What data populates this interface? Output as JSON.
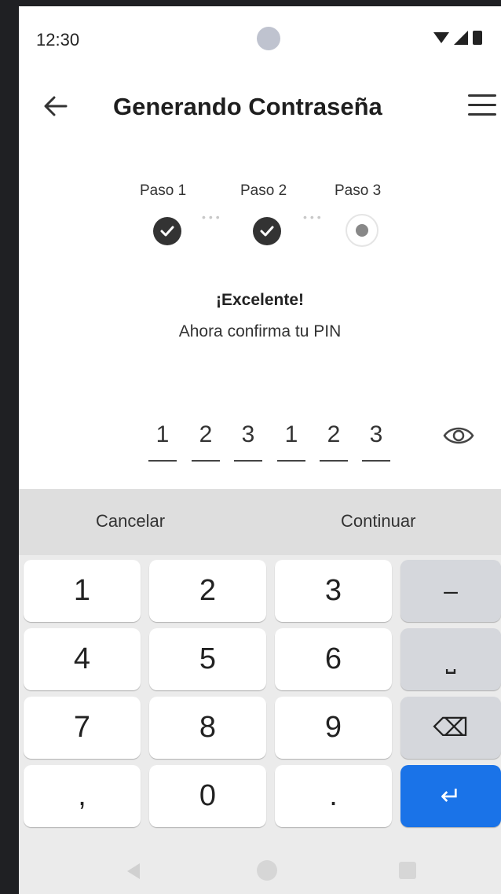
{
  "status": {
    "time": "12:30"
  },
  "header": {
    "title": "Generando Contraseña"
  },
  "stepper": {
    "steps": [
      {
        "label": "Paso 1",
        "state": "done"
      },
      {
        "label": "Paso 2",
        "state": "done"
      },
      {
        "label": "Paso 3",
        "state": "current"
      }
    ],
    "check_glyph": "✓"
  },
  "message": {
    "title": "¡Excelente!",
    "subtitle": "Ahora confirma tu PIN"
  },
  "pin": {
    "digits": [
      "1",
      "2",
      "3",
      "1",
      "2",
      "3"
    ]
  },
  "actions": {
    "cancel": "Cancelar",
    "continue": "Continuar"
  },
  "keyboard": {
    "keys": [
      "1",
      "2",
      "3",
      "–",
      "4",
      "5",
      "6",
      "⎵",
      "7",
      "8",
      "9",
      "⌫",
      ",",
      "0",
      ".",
      "↵"
    ]
  },
  "colors": {
    "enter_key": "#1a73e8",
    "fn_key": "#d5d7dc"
  }
}
